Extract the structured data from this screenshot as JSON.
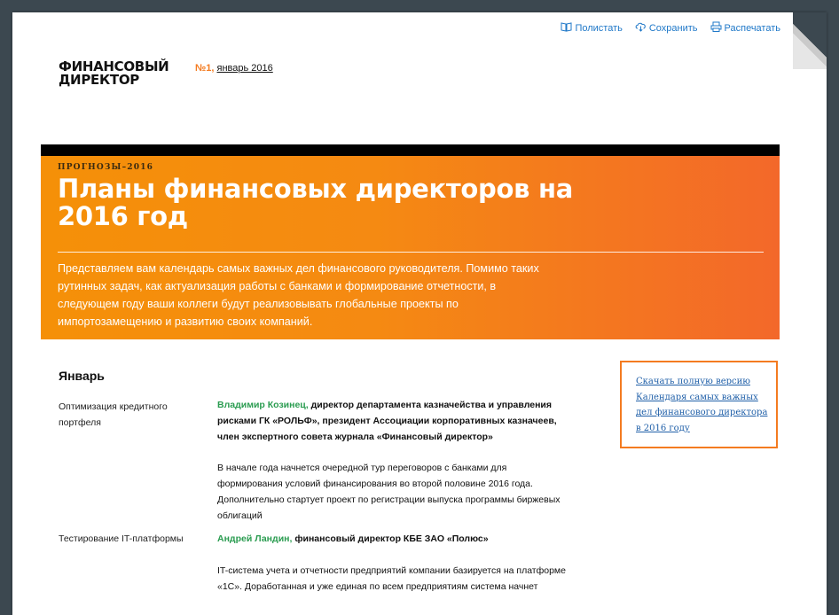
{
  "toolbar": {
    "flip_label": "Полистать",
    "save_label": "Сохранить",
    "print_label": "Распечатать"
  },
  "logo": {
    "line1": "ФИНАНСОВЫЙ",
    "line2": "ДИРЕКТОР"
  },
  "issue": {
    "number": "№1,",
    "date": "январь 2016"
  },
  "hero": {
    "kicker": "ПРОГНОЗЫ–2016",
    "title": "Планы финансовых директоров на 2016 год",
    "lead": "Представляем вам календарь самых важных дел финансового руководителя. Помимо таких рутинных задач, как актуализация работы с банками и формирование отчетности, в следующем году ваши коллеги будут реализовывать глобальные проекты по импортозамещению и развитию своих компаний."
  },
  "main": {
    "month": "Январь",
    "entries": [
      {
        "label": "Оптимизация кредитного портфеля",
        "person_name": "Владимир Козинец,",
        "person_role": " директор департамента казначейства и управления рисками ГК «РОЛЬФ», президент Ассоциации корпоративных казначеев, член экспертного совета журнала «Финансовый директор»",
        "text": "В начале года начнется очередной тур переговоров с банками для формирования условий финансирования во второй половине 2016 года. Дополнительно стартует проект по регистрации выпуска программы биржевых облигаций"
      },
      {
        "label": "Тестирование IT-платформы",
        "person_name": "Андрей Ландин,",
        "person_role": " финансовый директор КБЕ ЗАО «Полюс»",
        "text": "IT-система учета и отчетности предприятий компании базируется на платформе «1С». Доработанная и уже единая по всем предприятиям система начнет"
      }
    ]
  },
  "download": {
    "link_text": "Скачать полную версию Календаря самых важных дел финансового директора в 2016 году"
  },
  "colors": {
    "accent": "#f47b20",
    "link": "#1f78c8",
    "name_green": "#2a9c50",
    "background": "#3c4850"
  }
}
